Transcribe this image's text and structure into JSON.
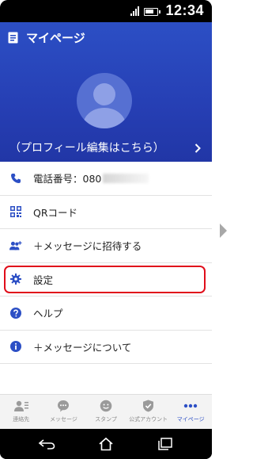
{
  "status_bar": {
    "time": "12:34",
    "battery_level": 0.8,
    "icons": [
      "signal-icon",
      "battery-icon"
    ]
  },
  "header": {
    "title": "マイページ",
    "title_icon": "document-icon",
    "profile_link": "（プロフィール編集はこちら）",
    "avatar_icon": "person-icon",
    "chevron_icon": "chevron-right-icon"
  },
  "menu": {
    "phone": {
      "label": "電話番号：080",
      "icon": "phone-icon"
    },
    "qr": {
      "label": "QRコード",
      "icon": "qr-code-icon"
    },
    "invite": {
      "label": "＋メッセージに招待する",
      "icon": "add-people-icon"
    },
    "settings": {
      "label": "設定",
      "icon": "gear-icon"
    },
    "help": {
      "label": "ヘルプ",
      "icon": "help-icon"
    },
    "about": {
      "label": "＋メッセージについて",
      "icon": "info-icon"
    }
  },
  "tabs": [
    {
      "label": "連絡先",
      "icon": "contacts-icon"
    },
    {
      "label": "メッセージ",
      "icon": "chat-bubble-icon"
    },
    {
      "label": "スタンプ",
      "icon": "sticker-icon"
    },
    {
      "label": "公式アカウント",
      "icon": "shield-check-icon"
    },
    {
      "label": "マイページ",
      "icon": "more-dots-icon",
      "active": true
    }
  ],
  "colors": {
    "accent": "#2c4fc5",
    "header_bg": "#263fb4",
    "highlight_border": "#e00d1a",
    "inactive_icon": "#9a9a9a"
  }
}
